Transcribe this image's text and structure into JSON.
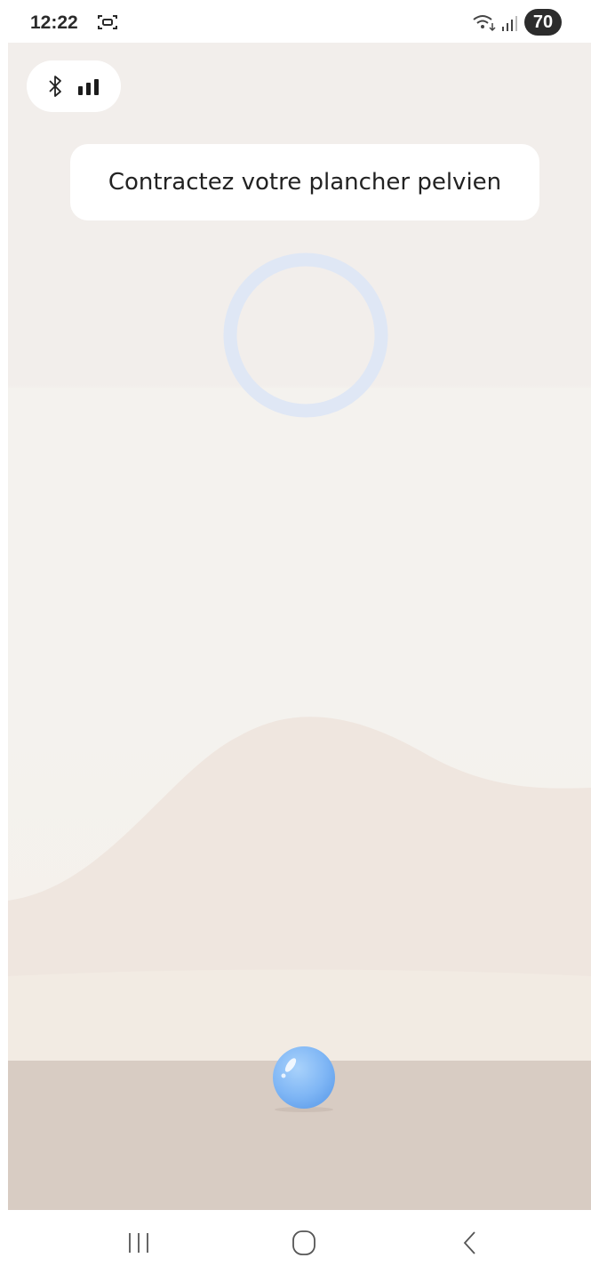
{
  "status_bar": {
    "time": "12:22",
    "battery_percent": "70",
    "icons": [
      "screenshot-icon",
      "wifi-icon",
      "signal-icon"
    ]
  },
  "device_status": {
    "icons": [
      "bluetooth-icon",
      "battery-level-icon"
    ]
  },
  "instruction": {
    "text": "Contractez votre plancher pelvien"
  },
  "game": {
    "target_ring_color": "#dfe7f5",
    "ball_color": "#7fb6f5",
    "ground_color": "#d8ccc3",
    "hill_color": "#efe3dc"
  },
  "nav_bar": {
    "icons": [
      "recents-icon",
      "home-icon",
      "back-icon"
    ]
  }
}
